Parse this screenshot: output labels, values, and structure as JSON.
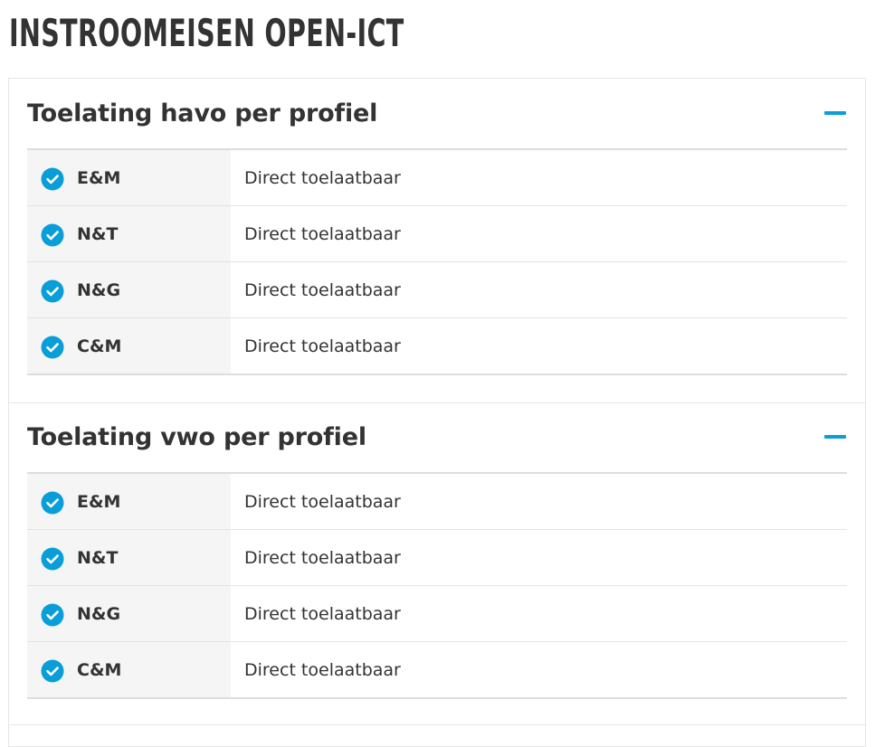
{
  "page": {
    "title": "INSTROOMEISEN OPEN-ICT"
  },
  "colors": {
    "accent": "#0a9ed9",
    "text": "#333333",
    "profile_cell_bg": "#f5f5f5"
  },
  "sections": [
    {
      "title": "Toelating havo per profiel",
      "toggle_icon": "minus-icon",
      "expanded": true,
      "rows": [
        {
          "profile": "E&M",
          "status": "Direct toelaatbaar",
          "icon": "check-circle-icon"
        },
        {
          "profile": "N&T",
          "status": "Direct toelaatbaar",
          "icon": "check-circle-icon"
        },
        {
          "profile": "N&G",
          "status": "Direct toelaatbaar",
          "icon": "check-circle-icon"
        },
        {
          "profile": "C&M",
          "status": "Direct toelaatbaar",
          "icon": "check-circle-icon"
        }
      ]
    },
    {
      "title": "Toelating vwo per profiel",
      "toggle_icon": "minus-icon",
      "expanded": true,
      "rows": [
        {
          "profile": "E&M",
          "status": "Direct toelaatbaar",
          "icon": "check-circle-icon"
        },
        {
          "profile": "N&T",
          "status": "Direct toelaatbaar",
          "icon": "check-circle-icon"
        },
        {
          "profile": "N&G",
          "status": "Direct toelaatbaar",
          "icon": "check-circle-icon"
        },
        {
          "profile": "C&M",
          "status": "Direct toelaatbaar",
          "icon": "check-circle-icon"
        }
      ]
    }
  ]
}
